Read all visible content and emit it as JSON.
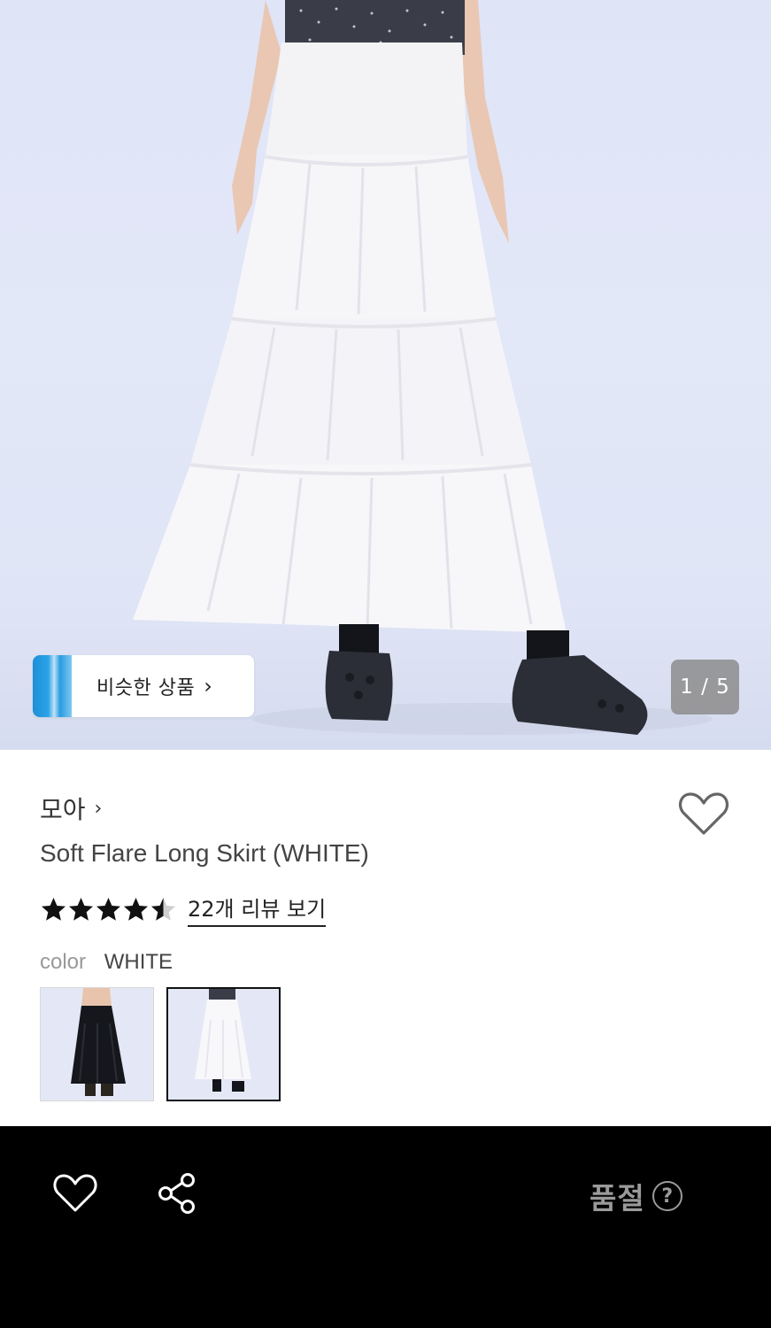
{
  "gallery": {
    "similar_button_label": "비슷한 상품",
    "similar_chevron": "›",
    "counter_text": "1 / 5"
  },
  "product": {
    "brand": "모아",
    "brand_chevron": "›",
    "title": "Soft Flare Long Skirt (WHITE)",
    "rating": 4.5,
    "review_link_text": "22개 리뷰 보기",
    "color_label": "color",
    "color_value": "WHITE",
    "swatches": [
      {
        "name": "black",
        "selected": false
      },
      {
        "name": "white",
        "selected": true
      }
    ],
    "wishlist_icon": "heart-outline-icon"
  },
  "bottom_bar": {
    "wish_icon": "heart-outline-icon",
    "share_icon": "share-icon",
    "status_label": "품절",
    "help_icon_glyph": "?"
  },
  "colors": {
    "bottom_bar_bg": "#000000",
    "soldout_text": "#9a9a9a",
    "counter_bg": "#8c8c8c"
  }
}
